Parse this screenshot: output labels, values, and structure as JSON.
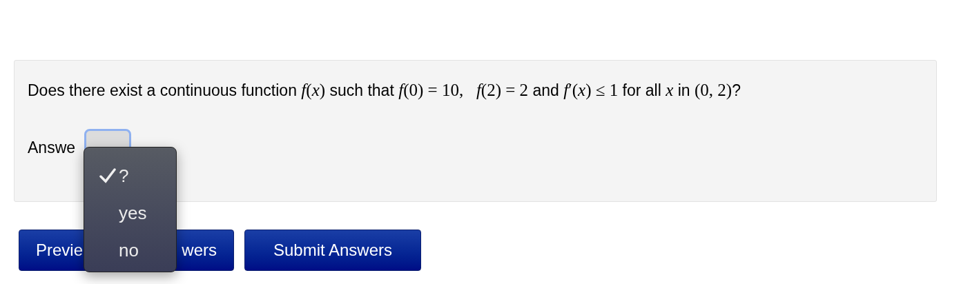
{
  "question": [
    {
      "kind": "text",
      "text": "Does there exist a continuous function "
    },
    {
      "kind": "math",
      "text": "*f*(*x*)"
    },
    {
      "kind": "text",
      "text": " such that "
    },
    {
      "kind": "math",
      "text": "*f*(0) = 10,   *f*(2) = 2"
    },
    {
      "kind": "text",
      "text": " and "
    },
    {
      "kind": "math",
      "text": "*f*′(*x*) ≤ 1"
    },
    {
      "kind": "text",
      "text": " for all "
    },
    {
      "kind": "math",
      "text": "*x*"
    },
    {
      "kind": "text",
      "text": " in "
    },
    {
      "kind": "math",
      "text": "(0, 2)"
    },
    {
      "kind": "text",
      "text": "?"
    }
  ],
  "answer": {
    "label": "Answe",
    "menu": [
      {
        "label": "?",
        "selected": true
      },
      {
        "label": "yes",
        "selected": false
      },
      {
        "label": "no",
        "selected": false
      }
    ]
  },
  "buttons": [
    {
      "label_start": "Previe",
      "label_end": "wers"
    },
    {
      "label_start": "Submit Answers"
    }
  ]
}
